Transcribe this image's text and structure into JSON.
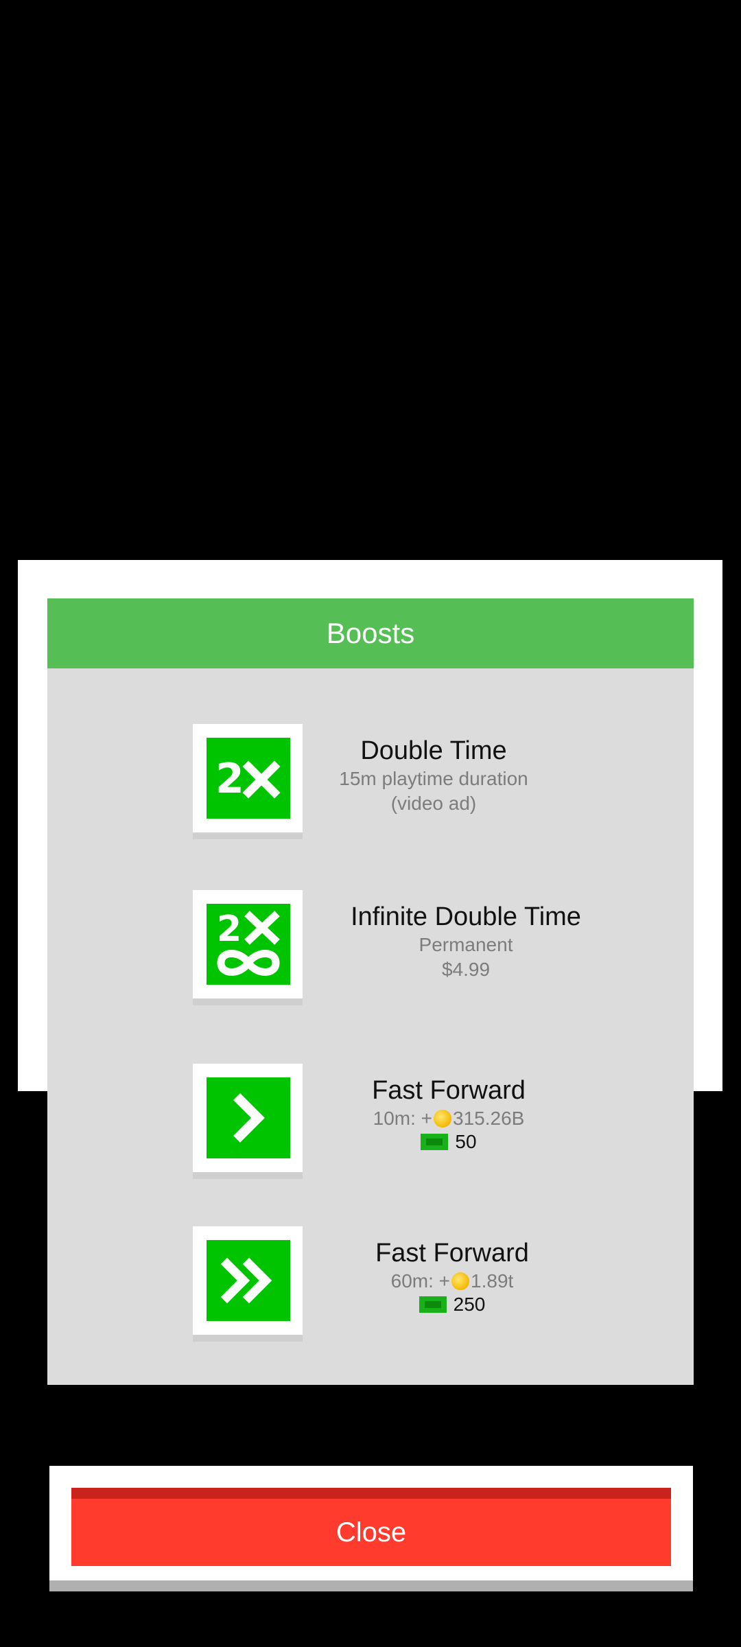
{
  "dialog": {
    "title": "Boosts",
    "items": [
      {
        "title": "Double Time",
        "line1": "15m playtime duration",
        "line2": "(video ad)",
        "icon": "double-time-icon"
      },
      {
        "title": "Infinite Double Time",
        "line1": "Permanent",
        "line2": "$4.99",
        "icon": "infinite-double-time-icon"
      },
      {
        "title": "Fast Forward",
        "line1_prefix": "10m: +",
        "line1_value": "315.26B",
        "price": "50",
        "icon": "fast-forward-icon"
      },
      {
        "title": "Fast Forward",
        "line1_prefix": "60m: +",
        "line1_value": "1.89t",
        "price": "250",
        "icon": "double-fast-forward-icon"
      }
    ]
  },
  "close": {
    "label": "Close"
  },
  "colors": {
    "header": "#55bf55",
    "tile": "#00c400",
    "close": "#ff3b2d"
  }
}
